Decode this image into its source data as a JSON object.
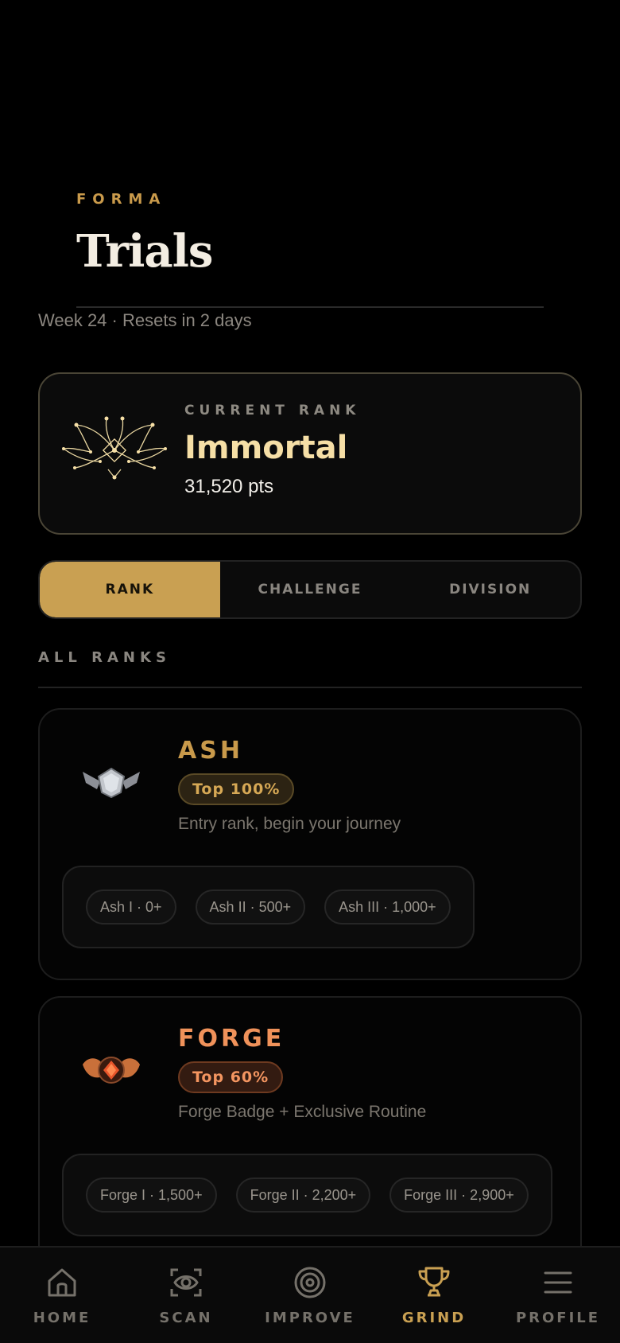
{
  "header": {
    "brand": "FORMA",
    "title": "Trials",
    "subtitle": "Week 24 · Resets in 2 days"
  },
  "current_rank": {
    "label": "CURRENT RANK",
    "name": "Immortal",
    "points": "31,520 pts",
    "emblem_icon": "immortal-emblem-icon"
  },
  "tabs": [
    {
      "label": "RANK",
      "active": true
    },
    {
      "label": "CHALLENGE",
      "active": false
    },
    {
      "label": "DIVISION",
      "active": false
    }
  ],
  "section": {
    "label": "ALL RANKS"
  },
  "tiers": [
    {
      "name": "ASH",
      "pill": "Top 100%",
      "description": "Entry rank, begin your journey",
      "icon": "ash-badge-icon",
      "accent": "#c99a4b",
      "sub_ranks": [
        "Ash I · 0+",
        "Ash II · 500+",
        "Ash III · 1,000+"
      ]
    },
    {
      "name": "FORGE",
      "pill": "Top 60%",
      "description": "Forge Badge + Exclusive Routine",
      "icon": "forge-badge-icon",
      "accent": "#f0925a",
      "sub_ranks": [
        "Forge I · 1,500+",
        "Forge II · 2,200+",
        "Forge III · 2,900+"
      ]
    }
  ],
  "nav": [
    {
      "label": "HOME",
      "icon": "home-icon",
      "active": false
    },
    {
      "label": "SCAN",
      "icon": "scan-icon",
      "active": false
    },
    {
      "label": "IMPROVE",
      "icon": "target-icon",
      "active": false
    },
    {
      "label": "GRIND",
      "icon": "trophy-icon",
      "active": true
    },
    {
      "label": "PROFILE",
      "icon": "menu-icon",
      "active": false
    }
  ],
  "colors": {
    "accent_gold": "#c9a052",
    "rank_name": "#f6dfa6",
    "background": "#000000"
  }
}
